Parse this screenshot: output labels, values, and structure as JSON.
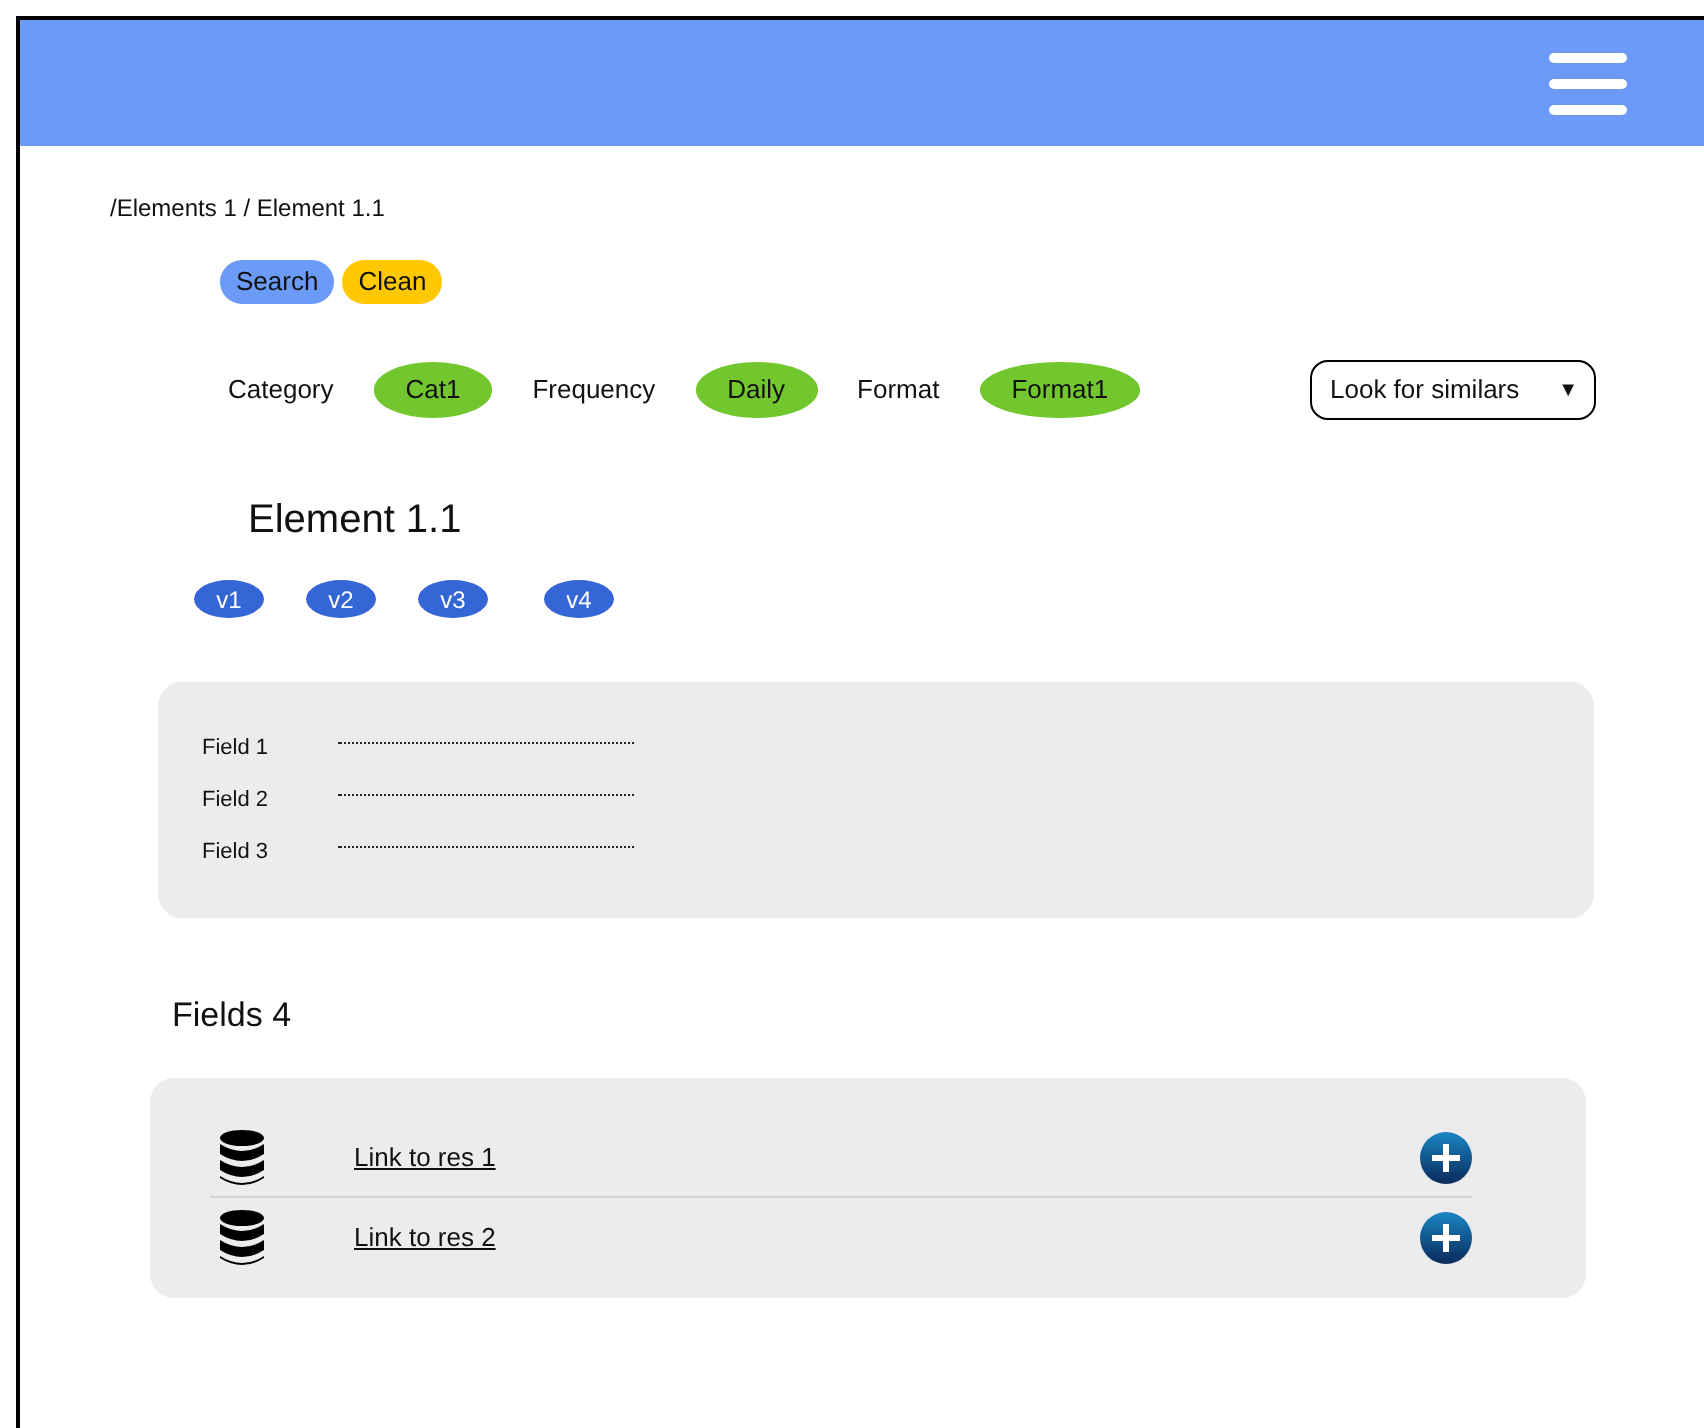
{
  "breadcrumb": "/Elements 1 / Element 1.1",
  "actions": [
    {
      "label": "Search",
      "kind": "primary"
    },
    {
      "label": "Clean",
      "kind": "warning"
    }
  ],
  "filters": [
    {
      "label": "Category",
      "value": "Cat1"
    },
    {
      "label": "Frequency",
      "value": "Daily"
    },
    {
      "label": "Format",
      "value": "Format1"
    }
  ],
  "similar_select": {
    "value": "Look for similars",
    "caret": "▼"
  },
  "title": "Element 1.1",
  "versions": [
    "v1",
    "v2",
    "v3",
    "v4"
  ],
  "fields": [
    {
      "label": "Field 1"
    },
    {
      "label": "Field 2"
    },
    {
      "label": "Field 3"
    }
  ],
  "resources_title": "Fields 4",
  "resources": [
    {
      "link": "Link to res 1"
    },
    {
      "link": "Link to res 2"
    }
  ]
}
